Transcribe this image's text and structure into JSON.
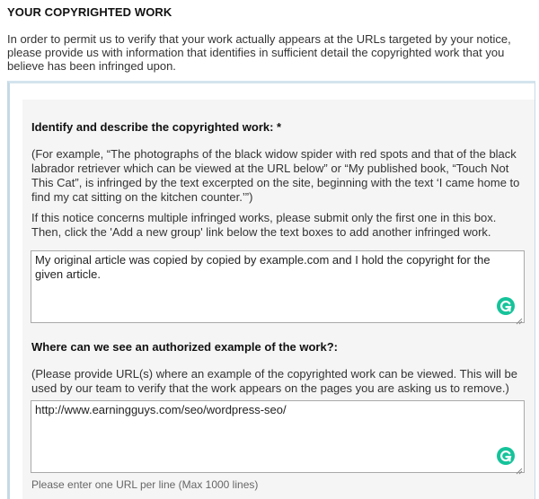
{
  "section": {
    "title": "YOUR COPYRIGHTED WORK",
    "intro": "In order to permit us to verify that your work actually appears at the URLs targeted by your notice, please provide us with information that identifies in sufficient detail the copyrighted work that you believe has been infringed upon."
  },
  "work_group": {
    "identify": {
      "label": "Identify and describe the copyrighted work: *",
      "example": "(For example, “The photographs of the black widow spider with red spots and that of the black labrador retriever which can be viewed at the URL below” or “My published book, “Touch Not This Cat”, is infringed by the text excerpted on the site, beginning with the text ‘I came home to find my cat sitting on the kitchen counter.’”)",
      "multiple_note": "If this notice concerns multiple infringed works, please submit only the first one in this box. Then, click the 'Add a new group' link below the text boxes to add another infringed work.",
      "value": "My original article was copied by copied by example.com and I hold the copyright for the given article."
    },
    "authorized": {
      "label": "Where can we see an authorized example of the work?:",
      "note": "(Please provide URL(s) where an example of the copyrighted work can be viewed. This will be used by our team to verify that the work appears on the pages you are asking us to remove.)",
      "value": "http://www.earningguys.com/seo/wordpress-seo/",
      "hint": "Please enter one URL per line (Max 1000 lines)"
    }
  },
  "icons": {
    "grammar_badge": "grammarly-g-icon",
    "resize": "resize-grip-icon"
  },
  "colors": {
    "panel_bg": "#f5f5f5",
    "outer_border": "#c7dbe7",
    "badge": "#15c39a"
  }
}
